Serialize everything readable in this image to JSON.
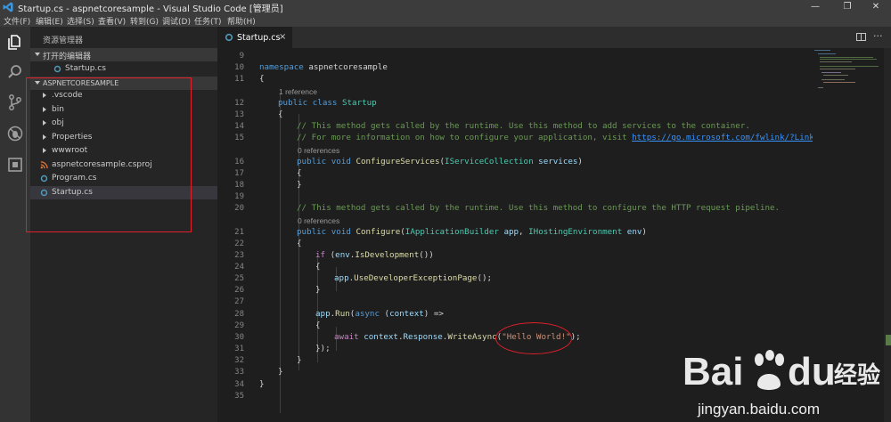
{
  "window": {
    "title": "Startup.cs - aspnetcoresample - Visual Studio Code [管理员]",
    "minimize": "—",
    "maximize": "❐",
    "close": "✕"
  },
  "menu": [
    "文件(F)",
    "编辑(E)",
    "选择(S)",
    "查看(V)",
    "转到(G)",
    "调试(D)",
    "任务(T)",
    "帮助(H)"
  ],
  "sidebar": {
    "title": "资源管理器",
    "open_editors": {
      "header": "打开的编辑器",
      "files": [
        "Startup.cs"
      ]
    },
    "project": {
      "header": "ASPNETCORESAMPLE",
      "items": [
        {
          "label": ".vscode",
          "kind": "folder"
        },
        {
          "label": "bin",
          "kind": "folder"
        },
        {
          "label": "obj",
          "kind": "folder"
        },
        {
          "label": "Properties",
          "kind": "folder"
        },
        {
          "label": "wwwroot",
          "kind": "folder"
        },
        {
          "label": "aspnetcoresample.csproj",
          "kind": "csproj"
        },
        {
          "label": "Program.cs",
          "kind": "cs"
        },
        {
          "label": "Startup.cs",
          "kind": "cs",
          "selected": true
        }
      ]
    }
  },
  "tab": {
    "label": "Startup.cs",
    "close": "×"
  },
  "editor": {
    "line_numbers": [
      "9",
      "10",
      "11",
      "12",
      "13",
      "14",
      "15",
      "16",
      "17",
      "18",
      "19",
      "20",
      "21",
      "22",
      "23",
      "24",
      "25",
      "26",
      "27",
      "28",
      "29",
      "30",
      "31",
      "32",
      "33",
      "34",
      "35"
    ],
    "references": [
      "1 reference",
      "0 references",
      "0 references"
    ],
    "ns_keyword": "namespace",
    "ns_name": "aspnetcoresample",
    "brace_open": "{",
    "brace_close": "}",
    "kw_public": "public",
    "kw_class": "class",
    "class_name": "Startup",
    "comment1": "// This method gets called by the runtime. Use this method to add services to the container.",
    "comment2_prefix": "// For more information on how to configure your application, visit ",
    "comment2_link": "https://go.microsoft.com/fwlink/?LinkID=",
    "kw_void": "void",
    "configure_services": "ConfigureServices",
    "type_iservice": "IServiceCollection",
    "param_services": "services",
    "comment3": "// This method gets called by the runtime. Use this method to configure the HTTP request pipeline.",
    "configure": "Configure",
    "type_iapp": "IApplicationBuilder",
    "param_app": "app",
    "type_ienv": "IHostingEnvironment",
    "param_env": "env",
    "kw_if": "if",
    "is_development": "IsDevelopment",
    "use_dev_page": "UseDeveloperExceptionPage",
    "run": "Run",
    "kw_async": "async",
    "param_context": "context",
    "kw_await": "await",
    "response": "Response",
    "write_async": "WriteAsync",
    "hello": "\"Hello World!\"",
    "close_lambda": "});"
  },
  "watermark": {
    "logo": "Baidu经验",
    "url": "jingyan.baidu.com"
  },
  "colors": {
    "annotation": "#e0202a",
    "accent": "#007acc"
  }
}
